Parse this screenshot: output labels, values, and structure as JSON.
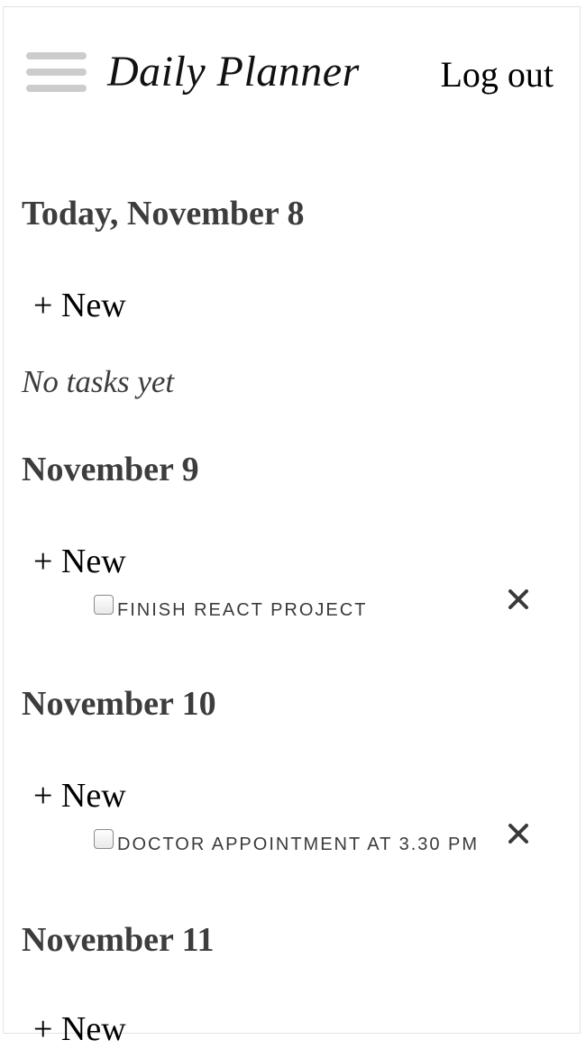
{
  "header": {
    "brand": "Daily Planner",
    "logout_label": "Log out",
    "menu_icon": "hamburger-menu-icon"
  },
  "days": [
    {
      "heading": "Today, November 8",
      "new_label": "+ New",
      "empty_text": "No tasks yet",
      "tasks": []
    },
    {
      "heading": "November 9",
      "new_label": "+ New",
      "tasks": [
        {
          "label": "FINISH REACT PROJECT",
          "done": false
        }
      ]
    },
    {
      "heading": "November 10",
      "new_label": "+ New",
      "tasks": [
        {
          "label": "DOCTOR APPOINTMENT AT 3.30 PM",
          "done": false
        }
      ]
    },
    {
      "heading": "November 11",
      "new_label": "+ New",
      "tasks": []
    }
  ],
  "colors": {
    "menu_bar": "#cccccc",
    "heading_text": "#3d3d3d",
    "remove_icon": "#3a3a3a"
  }
}
